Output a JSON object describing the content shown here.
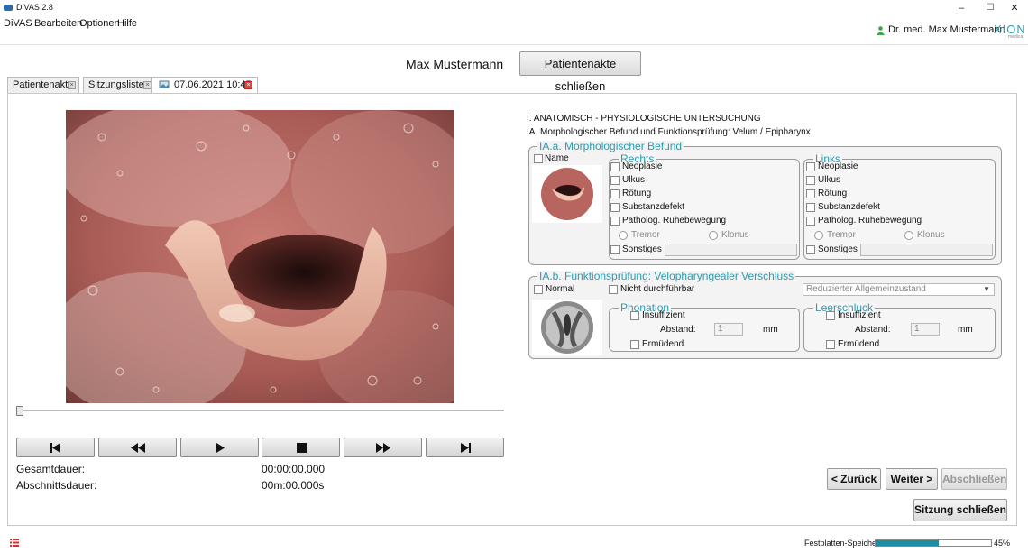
{
  "window": {
    "title": "DiVAS 2.8",
    "minimize": "–",
    "maximize": "☐",
    "close": "✕"
  },
  "menu": [
    "DiVAS",
    "Bearbeiten",
    "Optionen",
    "Hilfe"
  ],
  "header": {
    "user": "Dr. med. Max Mustermann",
    "logo": "XION",
    "logo_sub": "medical"
  },
  "patient": {
    "name": "Max Mustermann",
    "close_file": "Patientenakte schließen"
  },
  "tabs": [
    {
      "label": "Patientenakte"
    },
    {
      "label": "Sitzungsliste"
    },
    {
      "label": "07.06.2021 10:45"
    }
  ],
  "video": {
    "gesamtdauer_label": "Gesamtdauer:",
    "gesamtdauer": "00:00:00.000",
    "abschnittsdauer_label": "Abschnittsdauer:",
    "abschnittsdauer": "00m:00.000s",
    "position": 0
  },
  "exam": {
    "title": "I. ANATOMISCH - PHYSIOLOGISCHE UNTERSUCHUNG",
    "subtitle": "IA. Morphologischer Befund und Funktionsprüfung: Velum / Epipharynx",
    "morph": {
      "legend": "IA.a. Morphologischer Befund",
      "name": "Name",
      "rechts": "Rechts",
      "links": "Links",
      "items": [
        "Neoplasie",
        "Ulkus",
        "Rötung",
        "Substanzdefekt",
        "Patholog. Ruhebewegung"
      ],
      "tremor": "Tremor",
      "klonus": "Klonus",
      "sonstiges": "Sonstiges"
    },
    "func": {
      "legend": "IA.b. Funktionsprüfung: Velopharyngealer Verschluss",
      "normal": "Normal",
      "nicht": "Nicht durchführbar",
      "dropdown": "Reduzierter Allgemeinzustand",
      "phonation": "Phonation",
      "leerschluck": "Leerschluck",
      "insuff": "Insuffizient",
      "abstand": "Abstand:",
      "abstand_val": "1",
      "unit": "mm",
      "ermuedend": "Ermüdend"
    }
  },
  "nav": {
    "back": "< Zurück",
    "next": "Weiter >",
    "finish": "Abschließen",
    "close_session": "Sitzung schließen"
  },
  "footer": {
    "disk_label": "Festplatten-Speicher:",
    "disk_value": "45%",
    "disk_fraction": 0.55
  }
}
